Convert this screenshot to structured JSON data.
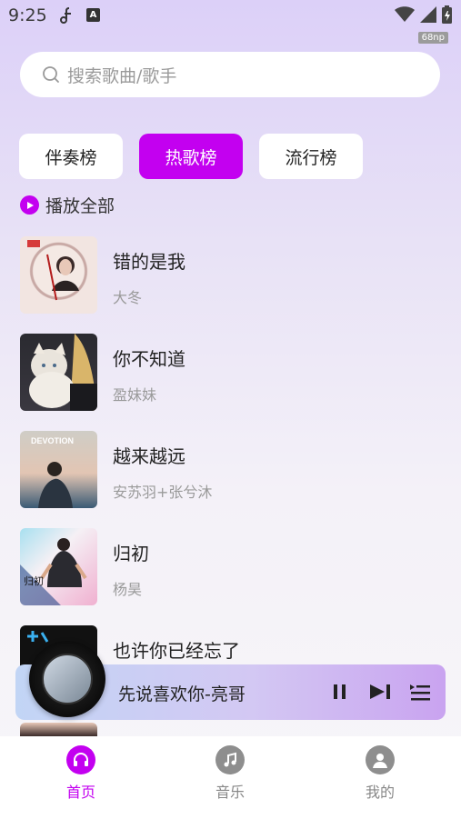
{
  "status": {
    "time": "9:25",
    "fps_badge": "68np"
  },
  "search": {
    "placeholder": "搜索歌曲/歌手"
  },
  "tabs": [
    {
      "label": "伴奏榜",
      "active": false
    },
    {
      "label": "热歌榜",
      "active": true
    },
    {
      "label": "流行榜",
      "active": false
    }
  ],
  "play_all": {
    "label": "播放全部"
  },
  "songs": [
    {
      "title": "错的是我",
      "artist": "大冬"
    },
    {
      "title": "你不知道",
      "artist": "盈妹妹"
    },
    {
      "title": "越来越远",
      "artist": "安苏羽+张兮沐",
      "cover_text": "DEVOTION"
    },
    {
      "title": "归初",
      "artist": "杨昊",
      "cover_text": "归初"
    },
    {
      "title": "也许你已经忘了",
      "artist": ""
    }
  ],
  "player": {
    "title": "先说喜欢你-亮哥"
  },
  "nav": [
    {
      "label": "首页",
      "icon": "headphones-icon",
      "active": true
    },
    {
      "label": "音乐",
      "icon": "music-note-icon",
      "active": false
    },
    {
      "label": "我的",
      "icon": "user-icon",
      "active": false
    }
  ],
  "colors": {
    "accent": "#c300f0",
    "background_top": "#dcd0f8"
  }
}
